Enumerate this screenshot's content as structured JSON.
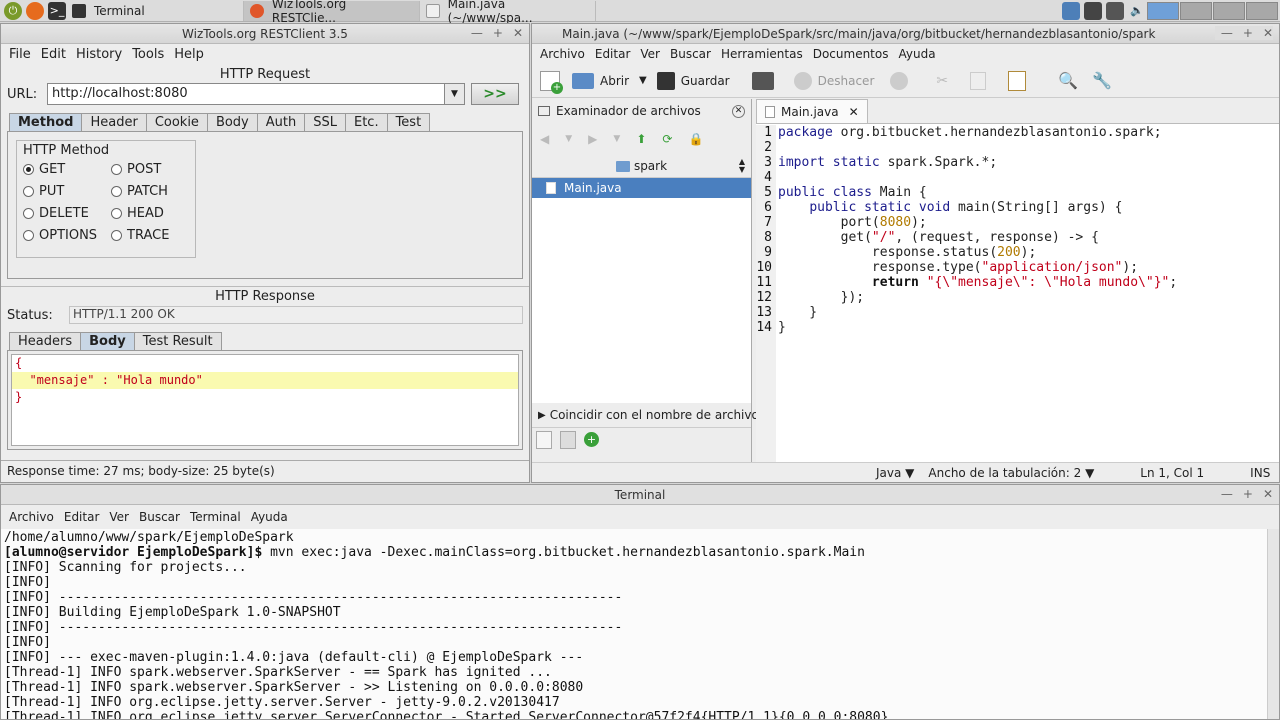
{
  "taskbar": {
    "tasks": [
      {
        "label": "Terminal"
      },
      {
        "label": "WizTools.org RESTClie..."
      },
      {
        "label": "Main.java (~/www/spa..."
      }
    ]
  },
  "restclient": {
    "title": "WizTools.org RESTClient 3.5",
    "menu": [
      "File",
      "Edit",
      "History",
      "Tools",
      "Help"
    ],
    "request_title": "HTTP Request",
    "url_label": "URL:",
    "url_value": "http://localhost:8080",
    "go_label": ">>",
    "req_tabs": [
      "Method",
      "Header",
      "Cookie",
      "Body",
      "Auth",
      "SSL",
      "Etc.",
      "Test"
    ],
    "method_group_label": "HTTP Method",
    "methods": [
      "GET",
      "POST",
      "PUT",
      "PATCH",
      "DELETE",
      "HEAD",
      "OPTIONS",
      "TRACE"
    ],
    "selected_method": "GET",
    "response_title": "HTTP Response",
    "status_label": "Status:",
    "status_value": "HTTP/1.1 200 OK",
    "resp_tabs": [
      "Headers",
      "Body",
      "Test Result"
    ],
    "body_lines": [
      "{",
      "  \"mensaje\" : \"Hola mundo\"",
      "}"
    ],
    "footer": "Response time: 27 ms; body-size: 25 byte(s)"
  },
  "gedit": {
    "title": "Main.java (~/www/spark/EjemploDeSpark/src/main/java/org/bitbucket/hernandezblasantonio/spark",
    "menu": [
      "Archivo",
      "Editar",
      "Ver",
      "Buscar",
      "Herramientas",
      "Documentos",
      "Ayuda"
    ],
    "toolbar": {
      "open": "Abrir",
      "save": "Guardar",
      "undo": "Deshacer"
    },
    "side_title": "Examinador de archivos",
    "folder": "spark",
    "file": "Main.java",
    "side_footer": "Coincidir con el nombre de archivo",
    "tab": "Main.java",
    "line_numbers": [
      "1",
      "2",
      "3",
      "4",
      "5",
      "6",
      "7",
      "8",
      "9",
      "10",
      "11",
      "12",
      "13",
      "14"
    ],
    "status": {
      "lang": "Java",
      "tab": "Ancho de la tabulación:  2",
      "pos": "Ln 1, Col 1",
      "mode": "INS"
    }
  },
  "terminal": {
    "title": "Terminal",
    "menu": [
      "Archivo",
      "Editar",
      "Ver",
      "Buscar",
      "Terminal",
      "Ayuda"
    ],
    "lines": [
      "/home/alumno/www/spark/EjemploDeSpark",
      "[INFO] Scanning for projects...",
      "[INFO]",
      "[INFO] ------------------------------------------------------------------------",
      "[INFO] Building EjemploDeSpark 1.0-SNAPSHOT",
      "[INFO] ------------------------------------------------------------------------",
      "[INFO]",
      "[INFO] --- exec-maven-plugin:1.4.0:java (default-cli) @ EjemploDeSpark ---",
      "[Thread-1] INFO spark.webserver.SparkServer - == Spark has ignited ...",
      "[Thread-1] INFO spark.webserver.SparkServer - >> Listening on 0.0.0.0:8080",
      "[Thread-1] INFO org.eclipse.jetty.server.Server - jetty-9.0.2.v20130417",
      "[Thread-1] INFO org.eclipse.jetty.server.ServerConnector - Started ServerConnector@57f2f4{HTTP/1.1}{0.0.0.0:8080}"
    ],
    "prompt": "[alumno@servidor EjemploDeSpark]$",
    "command": " mvn exec:java -Dexec.mainClass=org.bitbucket.hernandezblasantonio.spark.Main"
  },
  "colors": {
    "accent": "#c8d6e5",
    "highlight": "#fafab0",
    "string": "#c0001a",
    "number": "#b07a00",
    "keyword": "#1c1c8c"
  }
}
